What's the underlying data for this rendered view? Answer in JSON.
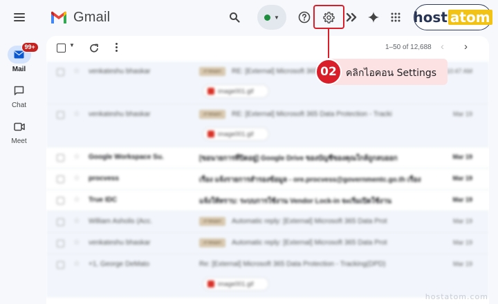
{
  "app": {
    "name": "Gmail"
  },
  "colors": {
    "accent_red": "#d91e2a",
    "callout_bg": "#fde2e3",
    "brand_navy": "#283453",
    "brand_yellow": "#f2c314",
    "online_green": "#1e8e3e"
  },
  "topbar": {
    "menu_icon": "hamburger-menu-icon",
    "search_icon": "search-icon",
    "status_icon": "status-dot-icon",
    "help_icon": "help-icon",
    "settings_icon": "gear-icon",
    "gemini_icon": "sparkle-icon",
    "apps_icon": "apps-grid-icon",
    "brand": {
      "host": "host",
      "atom": "atom"
    }
  },
  "rail": [
    {
      "label": "Mail",
      "badge": "99+",
      "icon": "mail-icon",
      "active": true
    },
    {
      "label": "Chat",
      "icon": "chat-icon",
      "active": false
    },
    {
      "label": "Meet",
      "icon": "video-icon",
      "active": false
    }
  ],
  "toolbar": {
    "pager": "1–50 of 12,688"
  },
  "emails": [
    {
      "sender": "venkateshu bhaskar",
      "tag": "ภายนอก",
      "subject": "RE: [External] Microsoft 365 Data",
      "date": "10:47 AM",
      "attachment": "image001.gif",
      "unread": false
    },
    {
      "sender": "venkateshu bhaskar",
      "tag": "ภายนอก",
      "subject": "RE: [External] Microsoft 365 Data Protection - Tracki",
      "date": "Mar 19",
      "attachment": "image001.gif",
      "unread": false
    },
    {
      "sender": "Google Workspace Su.",
      "tag": "",
      "subject": "[ขอนายการที่ปิดอยู่] Google Drive ของบัญชีของคุณใกล้ถูกลบออก",
      "date": "Mar 19",
      "unread": true
    },
    {
      "sender": "procvess",
      "tag": "",
      "subject": "เรื่อง แจ้งรายการสำรองข้อมูล - ore.procvess@governmentc.go.th เรื่อง",
      "date": "Mar 19",
      "unread": true
    },
    {
      "sender": "True IDC",
      "tag": "",
      "subject": "แจ้งให้ทราบ: ระบบการใช้งาน Vendor Lock-in จะเริ่มเปิดใช้งาน",
      "date": "Mar 19",
      "unread": true
    },
    {
      "sender": "William Asholis (Acc.",
      "tag": "ภายนอก",
      "subject": "Automatic reply: [External] Microsoft 365 Data Prot",
      "date": "Mar 19",
      "unread": false
    },
    {
      "sender": "venkateshu bhaskar",
      "tag": "ภายนอก",
      "subject": "Automatic reply: [External] Microsoft 365 Data Prot",
      "date": "Mar 19",
      "unread": false
    },
    {
      "sender": "+1,   George DeMato",
      "tag": "",
      "subject": "Re: [External] Microsoft 365 Data Protection - Tracking(DPD)",
      "date": "Mar 19",
      "attachment": "image001.gif",
      "unread": false
    }
  ],
  "callout": {
    "number": "02",
    "text": "คลิกไอคอน Settings"
  },
  "watermark": "hostatom.com"
}
